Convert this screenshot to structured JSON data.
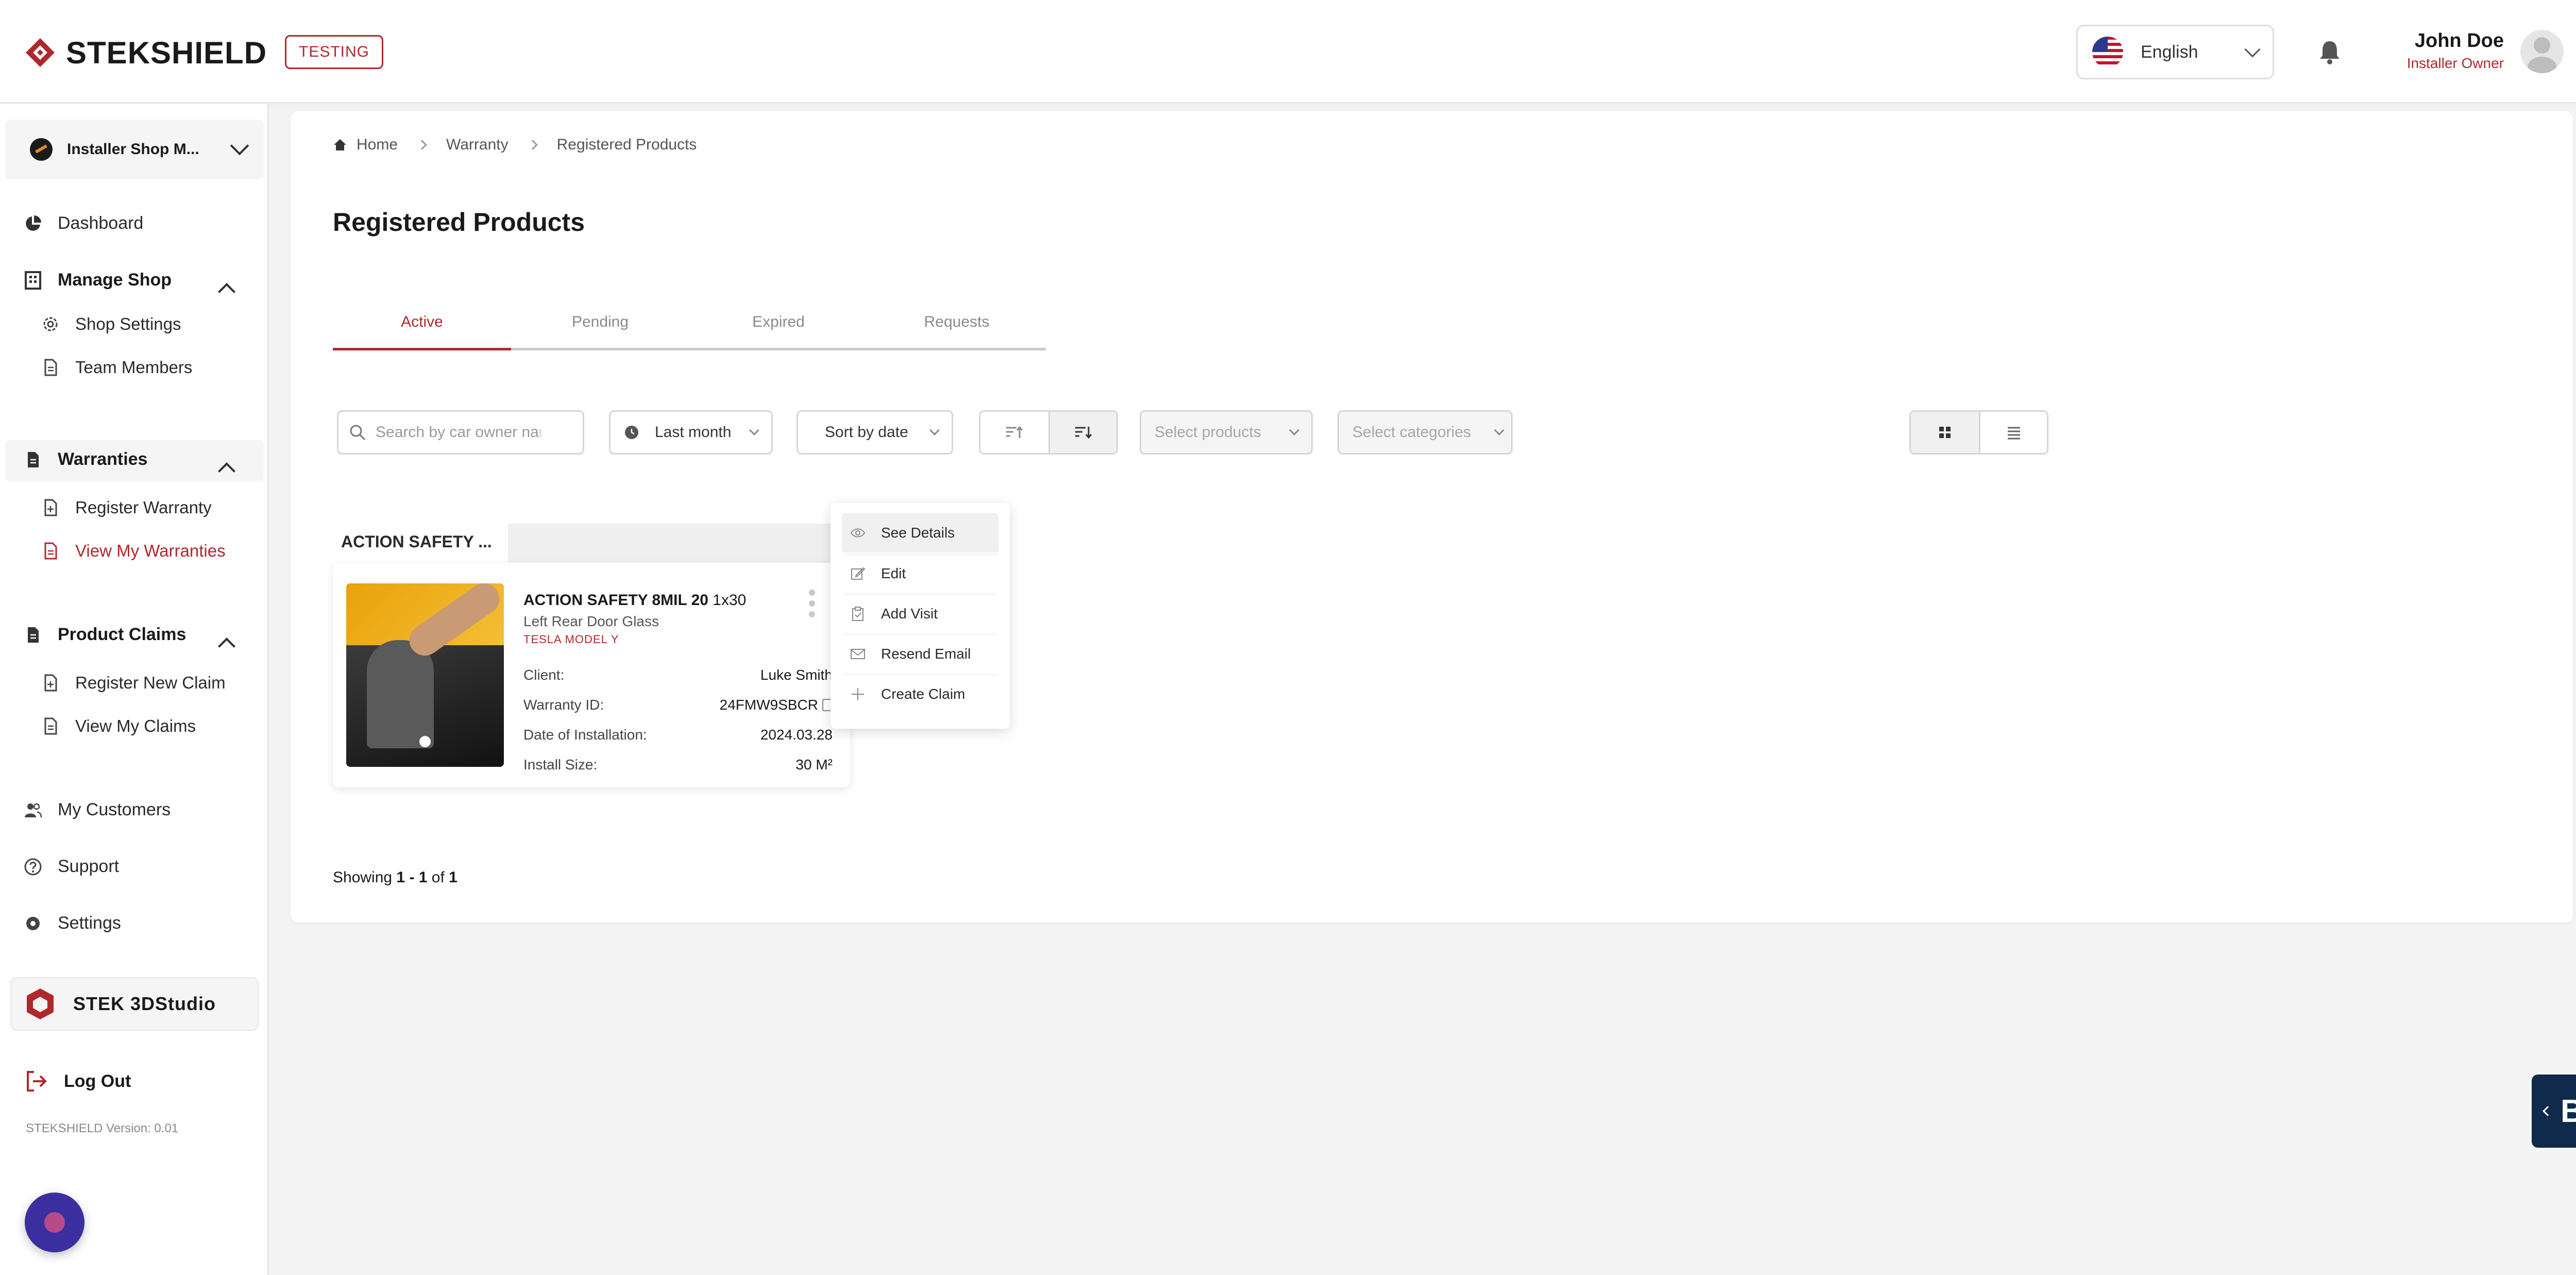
{
  "brand": {
    "name": "STEKSHIELD",
    "env_badge": "TESTING",
    "accent_color": "#b0282c"
  },
  "header": {
    "language": "English",
    "user_name": "John Doe",
    "user_role": "Installer Owner"
  },
  "sidebar": {
    "shop_name": "Installer Shop M...",
    "dashboard": "Dashboard",
    "manage_shop": "Manage Shop",
    "shop_settings": "Shop Settings",
    "team_members": "Team Members",
    "warranties": "Warranties",
    "register_warranty": "Register Warranty",
    "view_my_warranties": "View My Warranties",
    "product_claims": "Product Claims",
    "register_new_claim": "Register New Claim",
    "view_my_claims": "View My Claims",
    "my_customers": "My Customers",
    "support": "Support",
    "settings": "Settings",
    "studio": "STEK 3DStudio",
    "logout": "Log Out",
    "version": "STEKSHIELD Version: 0.01"
  },
  "breadcrumb": {
    "home": "Home",
    "warranty": "Warranty",
    "current": "Registered Products"
  },
  "page_title": "Registered Products",
  "tabs": [
    "Active",
    "Pending",
    "Expired",
    "Requests"
  ],
  "filters": {
    "search_placeholder": "Search by car owner name",
    "period": "Last month",
    "sort": "Sort by date",
    "products_placeholder": "Select products",
    "categories_placeholder": "Select categories"
  },
  "card": {
    "header": "ACTION SAFETY ...",
    "title_bold": "ACTION SAFETY 8MIL 20",
    "title_rest": " 1x30",
    "subtitle": "Left Rear Door Glass",
    "car": "TESLA MODEL Y",
    "client_label": "Client:",
    "client_value": "Luke Smith",
    "warranty_label": "Warranty ID:",
    "warranty_value": "24FMW9SBCR",
    "install_date_label": "Date of Installation:",
    "install_date_value": "2024.03.28",
    "install_size_label": "Install Size:",
    "install_size_value": "30 M²"
  },
  "context_menu": {
    "see_details": "See Details",
    "edit": "Edit",
    "add_visit": "Add Visit",
    "resend_email": "Resend Email",
    "create_claim": "Create Claim"
  },
  "pagination": {
    "prefix": "Showing ",
    "range": "1 - 1",
    "of": " of ",
    "total": "1"
  },
  "widget": {
    "label": "BH"
  }
}
